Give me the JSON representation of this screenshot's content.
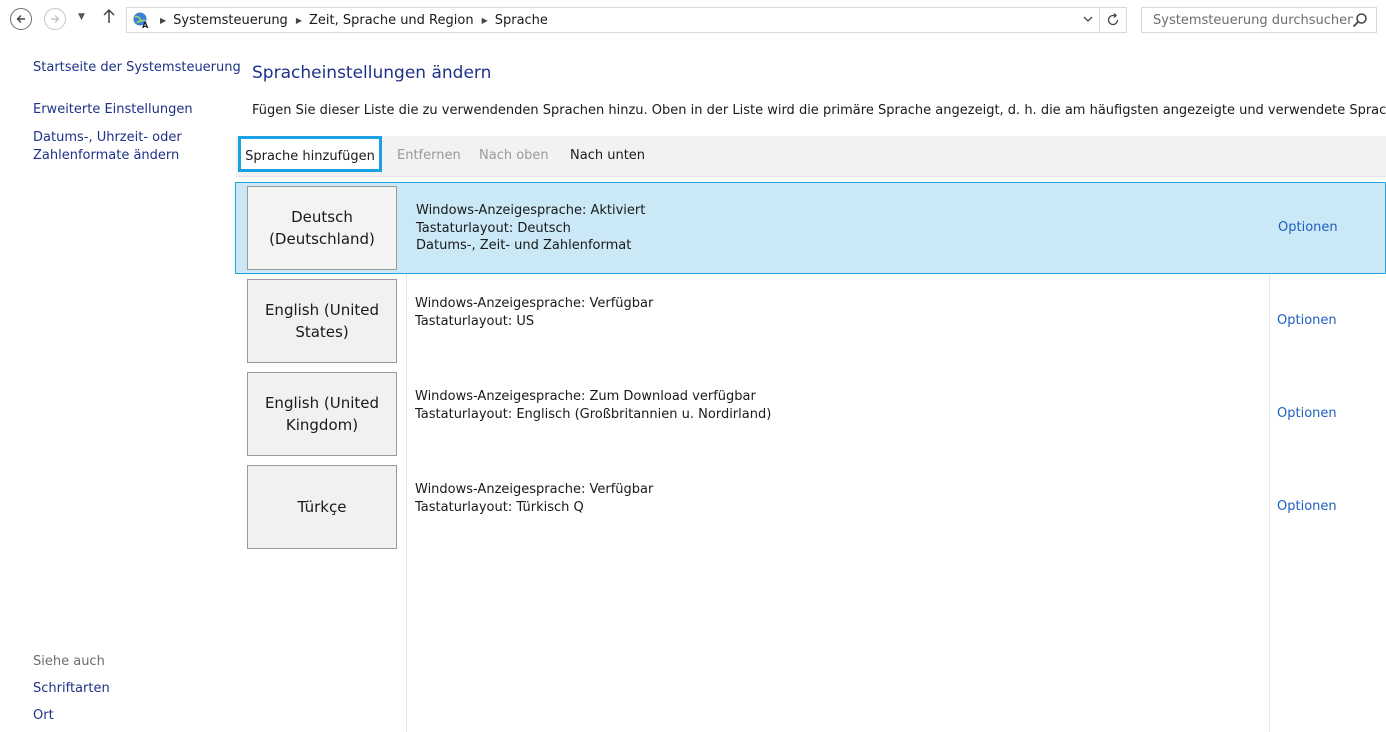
{
  "address_bar": {
    "breadcrumbs": [
      "Systemsteuerung",
      "Zeit, Sprache und Region",
      "Sprache"
    ],
    "search_placeholder": "Systemsteuerung durchsuchen"
  },
  "sidebar": {
    "links": [
      {
        "label": "Startseite der Systemsteuerung"
      },
      {
        "label": "Erweiterte Einstellungen"
      },
      {
        "label": "Datums-, Uhrzeit- oder Zahlenformate ändern"
      }
    ],
    "see_also_header": "Siehe auch",
    "see_also": [
      {
        "label": "Schriftarten"
      },
      {
        "label": "Ort"
      }
    ]
  },
  "main": {
    "title": "Spracheinstellungen ändern",
    "description": "Fügen Sie dieser Liste die zu verwendenden Sprachen hinzu. Oben in der Liste wird die primäre Sprache angezeigt, d. h. die am häufigsten angezeigte und verwendete Sprache.",
    "toolbar": {
      "add": "Sprache hinzufügen",
      "remove": "Entfernen",
      "up": "Nach oben",
      "down": "Nach unten"
    },
    "languages": [
      {
        "name": "Deutsch (Deutschland)",
        "lines": [
          "Windows-Anzeigesprache: Aktiviert",
          "Tastaturlayout: Deutsch",
          "Datums-, Zeit- und Zahlenformat"
        ],
        "options": "Optionen",
        "selected": true
      },
      {
        "name": "English (United States)",
        "lines": [
          "Windows-Anzeigesprache: Verfügbar",
          "Tastaturlayout: US",
          ""
        ],
        "options": "Optionen",
        "selected": false
      },
      {
        "name": "English (United Kingdom)",
        "lines": [
          "Windows-Anzeigesprache: Zum Download verfügbar",
          "Tastaturlayout: Englisch (Großbritannien u. Nordirland)",
          ""
        ],
        "options": "Optionen",
        "selected": false
      },
      {
        "name": "Türkçe",
        "lines": [
          "Windows-Anzeigesprache: Verfügbar",
          "Tastaturlayout: Türkisch Q",
          ""
        ],
        "options": "Optionen",
        "selected": false
      }
    ]
  },
  "colors": {
    "link": "#1e3287",
    "selection_bg": "#cbe8f6",
    "selection_border": "#26a0da",
    "highlight_frame": "#1ba1e2"
  }
}
